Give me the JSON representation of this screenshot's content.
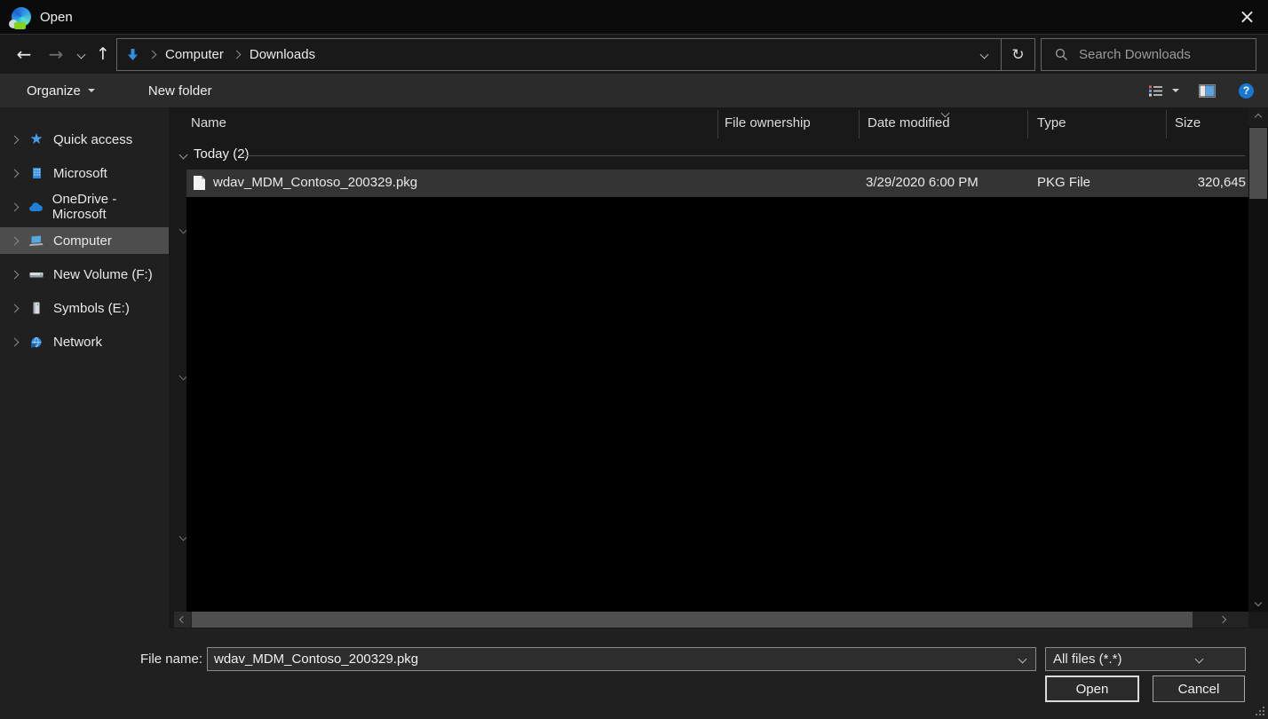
{
  "window": {
    "title": "Open"
  },
  "icons": {
    "back": "←",
    "forward": "→",
    "up": "↑",
    "refresh": "↻",
    "close": "×",
    "star": "★",
    "help": "?"
  },
  "navbar": {
    "breadcrumb": {
      "items": [
        "Computer",
        "Downloads"
      ]
    },
    "search": {
      "placeholder": "Search Downloads"
    }
  },
  "toolbar": {
    "organize_label": "Organize",
    "new_folder_label": "New folder"
  },
  "sidebar": {
    "items": [
      {
        "label": "Quick access",
        "icon": "quick-access-star",
        "selected": false
      },
      {
        "label": "Microsoft",
        "icon": "building",
        "selected": false
      },
      {
        "label": "OneDrive - Microsoft",
        "icon": "onedrive-cloud",
        "selected": false
      },
      {
        "label": "Computer",
        "icon": "computer",
        "selected": true
      },
      {
        "label": "New Volume (F:)",
        "icon": "external-drive",
        "selected": false
      },
      {
        "label": "Symbols (E:)",
        "icon": "tower-drive",
        "selected": false
      },
      {
        "label": "Network",
        "icon": "network-globe",
        "selected": false
      }
    ]
  },
  "file_list": {
    "columns": [
      {
        "label": "Name"
      },
      {
        "label": "File ownership"
      },
      {
        "label": "Date modified",
        "sort": "descending"
      },
      {
        "label": "Type"
      },
      {
        "label": "Size"
      }
    ],
    "group": {
      "label": "Today (2)"
    },
    "rows": [
      {
        "name": "wdav_MDM_Contoso_200329.pkg",
        "file_ownership": "",
        "date_modified": "3/29/2020 6:00 PM",
        "type": "PKG File",
        "size": "320,645"
      }
    ]
  },
  "footer": {
    "file_name_label": "File name:",
    "file_name_value": "wdav_MDM_Contoso_200329.pkg",
    "file_type_selected": "All files (*.*)",
    "open_label": "Open",
    "cancel_label": "Cancel"
  },
  "colors": {
    "titlebar_bg": "#0b0b0b",
    "chrome_bg": "#191919",
    "toolbar_bg": "#2b2b2b",
    "panel_bg": "#202020",
    "sidebar_selected_bg": "#4d4d4d",
    "row_selected_bg": "#343434",
    "accent_blue": "#2f8fe0",
    "help_blue": "#1778d2",
    "text": "#e8e8e8",
    "muted_text": "#9a9a9a",
    "border": "#666666"
  }
}
